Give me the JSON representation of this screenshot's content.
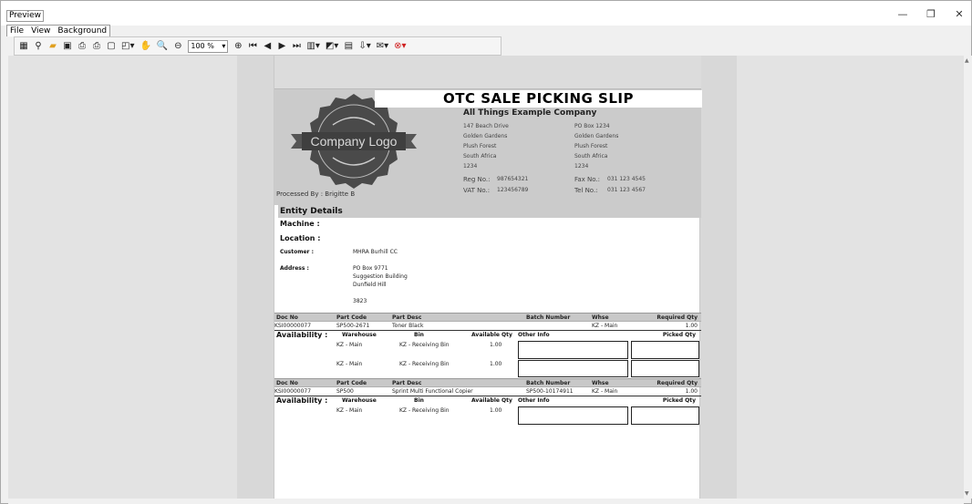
{
  "window": {
    "title": "Preview",
    "minimize": "—",
    "restore": "❐",
    "close": "✕"
  },
  "menu": [
    "File",
    "View",
    "Background"
  ],
  "toolbar": {
    "icons": [
      {
        "name": "thumbnails-icon",
        "glyph": "▦"
      },
      {
        "name": "find-icon",
        "glyph": "⚲"
      },
      {
        "name": "open-folder-icon",
        "glyph": "▰"
      },
      {
        "name": "save-icon",
        "glyph": "▣"
      },
      {
        "name": "print-icon",
        "glyph": "⎙"
      },
      {
        "name": "quick-print-icon",
        "glyph": "⎙"
      },
      {
        "name": "page-setup-icon",
        "glyph": "▢"
      },
      {
        "name": "scale-icon",
        "glyph": "◰▾"
      },
      {
        "name": "hand-tool-icon",
        "glyph": "✋"
      },
      {
        "name": "magnifier-icon",
        "glyph": "🔍"
      },
      {
        "name": "zoom-out-icon",
        "glyph": "⊖"
      }
    ],
    "zoom": "100 %",
    "icons2": [
      {
        "name": "zoom-in-icon",
        "glyph": "⊕"
      },
      {
        "name": "first-page-icon",
        "glyph": "⏮"
      },
      {
        "name": "previous-page-icon",
        "glyph": "◀"
      },
      {
        "name": "next-page-icon",
        "glyph": "▶"
      },
      {
        "name": "last-page-icon",
        "glyph": "⏭"
      },
      {
        "name": "multiple-pages-icon",
        "glyph": "▥▾"
      },
      {
        "name": "background-color-icon",
        "glyph": "◩▾"
      },
      {
        "name": "watermark-icon",
        "glyph": "▤"
      },
      {
        "name": "export-icon",
        "glyph": "⇩▾"
      },
      {
        "name": "send-email-icon",
        "glyph": "✉▾"
      },
      {
        "name": "close-preview-icon",
        "glyph": "⊗▾"
      }
    ]
  },
  "report": {
    "title": "OTC SALE PICKING SLIP",
    "company": "All Things Example Company",
    "logo_text": "Company Logo",
    "address_left": [
      "147 Beach Drive",
      "Golden Gardens",
      "Plush Forest",
      "South Africa",
      "1234"
    ],
    "address_right": [
      "PO Box 1234",
      "Golden Gardens",
      "Plush Forest",
      "South Africa",
      "1234"
    ],
    "reg_label": "Reg No.:",
    "reg_value": "987654321",
    "vat_label": "VAT No.:",
    "vat_value": "123456789",
    "fax_label": "Fax No.:",
    "fax_value": "031 123 4545",
    "tel_label": "Tel No.:",
    "tel_value": "031 123 4567",
    "processed_by": "Processed By : Brigitte B",
    "entity_heading": "Entity Details",
    "machine_label": "Machine :",
    "location_label": "Location :",
    "customer_label": "Customer :",
    "customer_value": "MHRA Burhill CC",
    "address_label": "Address :",
    "address_lines": [
      "PO Box 9771",
      "Suggestion Building",
      "Dunfield Hill",
      "",
      "3823"
    ],
    "cols": {
      "doc": "Doc No",
      "code": "Part Code",
      "desc": "Part Desc",
      "batch": "Batch Number",
      "whse": "Whse",
      "req": "Required Qty"
    },
    "avail_label": "Availability :",
    "avail_cols": {
      "warehouse": "Warehouse",
      "bin": "Bin",
      "avail": "Available Qty",
      "other": "Other Info",
      "picked": "Picked Qty"
    },
    "items": [
      {
        "doc": "KSI00000077",
        "code": "SP500-2671",
        "desc": "Toner Black",
        "batch": "",
        "whse": "KZ - Main",
        "req": "1.00",
        "avail": [
          {
            "warehouse": "KZ - Main",
            "bin": "KZ - Receiving Bin",
            "qty": "1.00"
          },
          {
            "warehouse": "KZ - Main",
            "bin": "KZ - Receiving Bin",
            "qty": "1.00"
          }
        ]
      },
      {
        "doc": "KSI00000077",
        "code": "SP500",
        "desc": "Sprint Multi Functional Copier",
        "batch": "SP500-10174911",
        "whse": "KZ - Main",
        "req": "1.00",
        "avail": [
          {
            "warehouse": "KZ - Main",
            "bin": "KZ - Receiving Bin",
            "qty": "1.00"
          }
        ]
      }
    ]
  }
}
